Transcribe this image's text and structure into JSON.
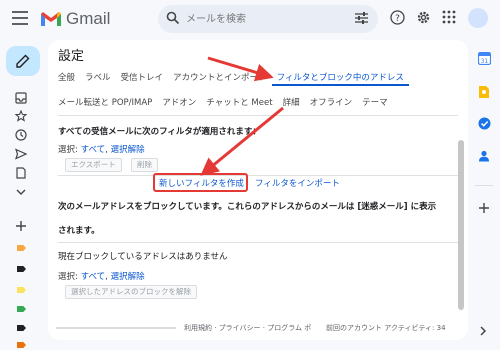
{
  "app": {
    "name": "Gmail",
    "accent": "#0b57d0",
    "annotation_color": "#e53935"
  },
  "search": {
    "placeholder": "メールを検索"
  },
  "settings": {
    "title": "設定",
    "tabs_row1": [
      "全般",
      "ラベル",
      "受信トレイ",
      "アカウントとインポート",
      "フィルタとブロック中のアドレス"
    ],
    "tabs_row2": [
      "メール転送と POP/IMAP",
      "アドオン",
      "チャットと Meet",
      "詳細",
      "オフライン",
      "テーマ"
    ],
    "active_tab": "フィルタとブロック中のアドレス",
    "filters": {
      "heading": "すべての受信メールに次のフィルタが適用されます：",
      "select_label": "選択:",
      "select_all": "すべて",
      "select_none": "選択解除",
      "export_button": "エクスポート",
      "delete_button": "削除",
      "create_filter": "新しいフィルタを作成",
      "import_filters": "フィルタをインポート"
    },
    "blocked": {
      "heading_line1": "次のメールアドレスをブロックしています。これらのアドレスからのメールは [迷惑メール] に表示",
      "heading_line2": "されます。",
      "none_text": "現在ブロックしているアドレスはありません",
      "select_label": "選択:",
      "select_all": "すべて",
      "select_none": "選択解除",
      "unblock_button": "選択したアドレスのブロックを解除"
    },
    "footer": {
      "terms": "利用規約 · プライバシー · プログラム ポ",
      "activity": "前回のアカウント アクティビティ: 34"
    }
  },
  "icons": {
    "hamburger": "menu-icon",
    "search": "search-icon",
    "tune": "tune-icon",
    "help": "help-icon",
    "settings": "gear-icon",
    "apps": "apps-grid-icon",
    "compose": "pencil-icon"
  }
}
